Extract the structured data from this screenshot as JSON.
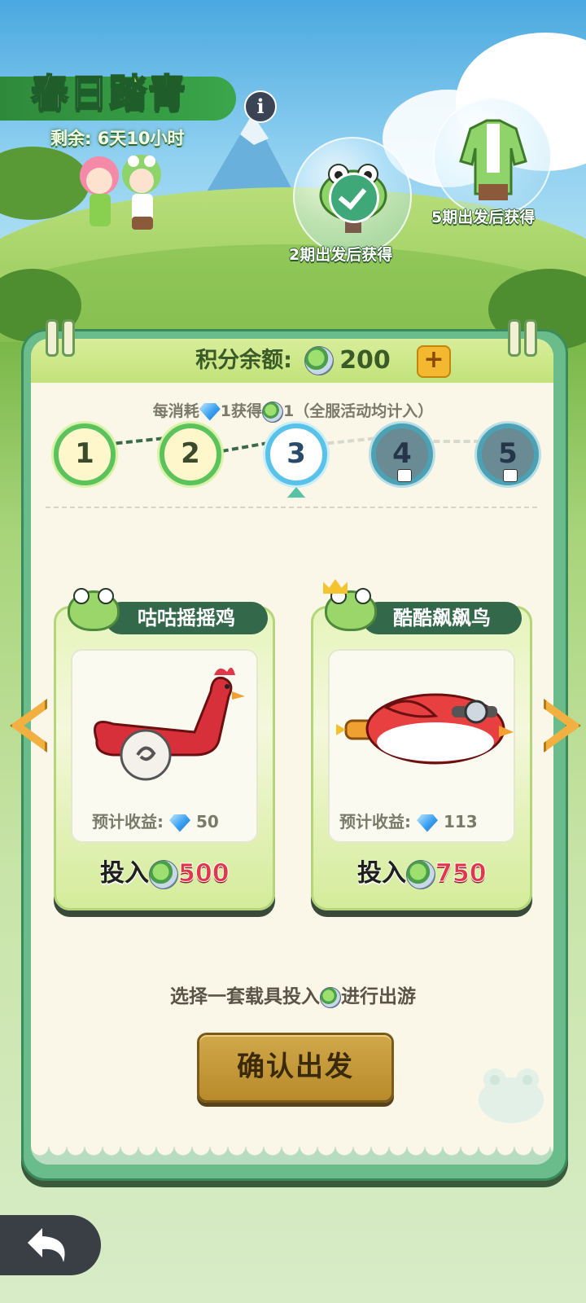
{
  "event": {
    "title_part1": "春日",
    "title_part2": "踏青",
    "remaining": "剩余: 6天10小时"
  },
  "rewards": [
    {
      "label": "2期出发后获得",
      "icon": "frog-hat-icon",
      "claimed": true
    },
    {
      "label": "5期出发后获得",
      "icon": "frog-jacket-icon",
      "claimed": false
    }
  ],
  "balance": {
    "label": "积分余额:",
    "value": "200",
    "add_label": "+"
  },
  "rule": {
    "part1": "每消耗",
    "part2": "1获得",
    "part3": "1（全服活动均计入）"
  },
  "stages": [
    {
      "num": "1",
      "state": "done"
    },
    {
      "num": "2",
      "state": "done"
    },
    {
      "num": "3",
      "state": "current"
    },
    {
      "num": "4",
      "state": "locked"
    },
    {
      "num": "5",
      "state": "locked"
    }
  ],
  "vehicles": [
    {
      "name": "咕咕摇摇鸡",
      "yield_label": "预计收益:",
      "yield_value": "50",
      "cost_label": "投入",
      "cost_value": "500",
      "icon": "rocking-chicken-icon",
      "crown": false
    },
    {
      "name": "酷酷飙飙鸟",
      "yield_label": "预计收益:",
      "yield_value": "113",
      "cost_label": "投入",
      "cost_value": "750",
      "icon": "jet-bird-icon",
      "crown": true
    }
  ],
  "hint": {
    "part1": "选择一套载具投入",
    "part2": "进行出游"
  },
  "confirm_label": "确认出发",
  "colors": {
    "accent_green": "#34684a",
    "cost_red": "#e03848",
    "confirm_gold": "#c49a3a"
  }
}
